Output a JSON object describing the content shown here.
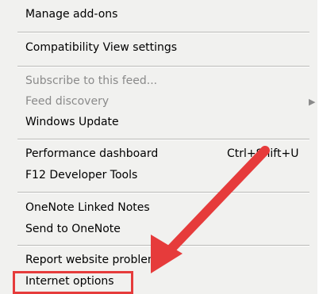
{
  "menu": {
    "items": [
      {
        "label": "Manage add-ons"
      },
      {
        "label": "Compatibility View settings"
      },
      {
        "label": "Subscribe to this feed..."
      },
      {
        "label": "Feed discovery"
      },
      {
        "label": "Windows Update"
      },
      {
        "label": "Performance dashboard",
        "shortcut": "Ctrl+Shift+U"
      },
      {
        "label": "F12 Developer Tools"
      },
      {
        "label": "OneNote Linked Notes"
      },
      {
        "label": "Send to OneNote"
      },
      {
        "label": "Report website problems"
      },
      {
        "label": "Internet options"
      }
    ]
  },
  "annotation": {
    "arrow_color": "#e63b3b",
    "highlight_color": "#e63b3b"
  }
}
